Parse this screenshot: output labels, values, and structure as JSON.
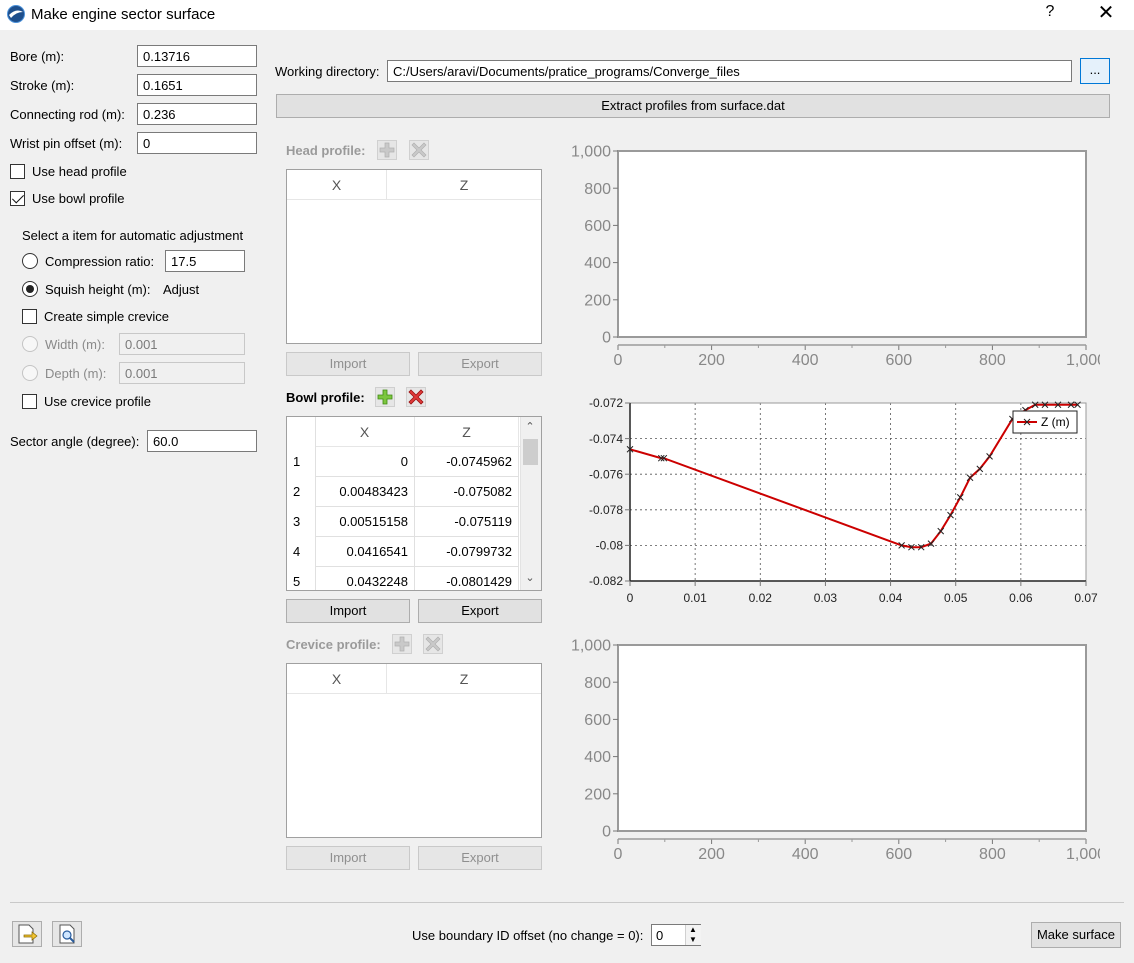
{
  "window": {
    "title": "Make engine sector surface",
    "help": "?",
    "close": "✕"
  },
  "params": {
    "bore_label": "Bore (m):",
    "bore": "0.13716",
    "stroke_label": "Stroke (m):",
    "stroke": "0.1651",
    "rod_label": "Connecting rod (m):",
    "rod": "0.236",
    "wrist_label": "Wrist pin offset (m):",
    "wrist": "0",
    "use_head": "Use head profile",
    "use_bowl": "Use bowl profile",
    "auto_adjust_label": "Select a item for automatic adjustment",
    "compression_label": "Compression ratio:",
    "compression": "17.5",
    "squish_label": "Squish height (m):",
    "squish_value": "Adjust",
    "simple_crevice": "Create simple crevice",
    "width_label": "Width (m):",
    "width": "0.001",
    "depth_label": "Depth (m):",
    "depth": "0.001",
    "use_crevice": "Use crevice profile",
    "sector_label": "Sector angle (degree):",
    "sector": "60.0"
  },
  "workdir": {
    "label": "Working directory:",
    "value": "C:/Users/aravi/Documents/pratice_programs/Converge_files",
    "browse": "...",
    "extract": "Extract profiles from surface.dat"
  },
  "head": {
    "label": "Head profile:",
    "columns": [
      "X",
      "Z"
    ],
    "import": "Import",
    "export": "Export"
  },
  "bowl": {
    "label": "Bowl profile:",
    "columns": [
      "X",
      "Z"
    ],
    "rows": [
      {
        "i": "1",
        "x": "0",
        "z": "-0.0745962"
      },
      {
        "i": "2",
        "x": "0.00483423",
        "z": "-0.075082"
      },
      {
        "i": "3",
        "x": "0.00515158",
        "z": "-0.075119"
      },
      {
        "i": "4",
        "x": "0.0416541",
        "z": "-0.0799732"
      },
      {
        "i": "5",
        "x": "0.0432248",
        "z": "-0.0801429"
      }
    ],
    "import": "Import",
    "export": "Export"
  },
  "crevice": {
    "label": "Crevice profile:",
    "columns": [
      "X",
      "Z"
    ],
    "import": "Import",
    "export": "Export"
  },
  "footer": {
    "offset_label": "Use boundary ID offset (no change = 0):",
    "offset": "0",
    "make": "Make surface"
  },
  "chart_data": [
    {
      "type": "line",
      "xlim": [
        0,
        1000
      ],
      "ylim": [
        0,
        1000
      ],
      "x_ticks": [
        "0",
        "200",
        "400",
        "600",
        "800",
        "1,000"
      ],
      "y_ticks": [
        "0",
        "200",
        "400",
        "600",
        "800",
        "1,000"
      ],
      "grid": false,
      "series": []
    },
    {
      "type": "line",
      "xlim": [
        0,
        0.07
      ],
      "ylim": [
        -0.082,
        -0.072
      ],
      "x_ticks": [
        "0",
        "0.01",
        "0.02",
        "0.03",
        "0.04",
        "0.05",
        "0.06",
        "0.07"
      ],
      "y_ticks": [
        "-0.072",
        "-0.074",
        "-0.076",
        "-0.078",
        "-0.08",
        "-0.082"
      ],
      "grid": true,
      "legend": "top-right",
      "color": "#cc0000",
      "series": [
        {
          "name": "Z (m)",
          "x": [
            0,
            0.0048,
            0.0052,
            0.0417,
            0.0432,
            0.0447,
            0.0462,
            0.0477,
            0.0492,
            0.0507,
            0.0522,
            0.0537,
            0.0552,
            0.0587,
            0.0607,
            0.0622,
            0.0637,
            0.0657,
            0.0677,
            0.0687
          ],
          "y": [
            -0.0746,
            -0.0751,
            -0.0751,
            -0.08,
            -0.0801,
            -0.0801,
            -0.0799,
            -0.0792,
            -0.0783,
            -0.0773,
            -0.0762,
            -0.0757,
            -0.075,
            -0.0729,
            -0.0724,
            -0.0721,
            -0.0721,
            -0.0721,
            -0.0721,
            -0.0721
          ]
        }
      ]
    },
    {
      "type": "line",
      "xlim": [
        0,
        1000
      ],
      "ylim": [
        0,
        1000
      ],
      "x_ticks": [
        "0",
        "200",
        "400",
        "600",
        "800",
        "1,000"
      ],
      "y_ticks": [
        "0",
        "200",
        "400",
        "600",
        "800",
        "1,000"
      ],
      "grid": false,
      "series": []
    }
  ]
}
